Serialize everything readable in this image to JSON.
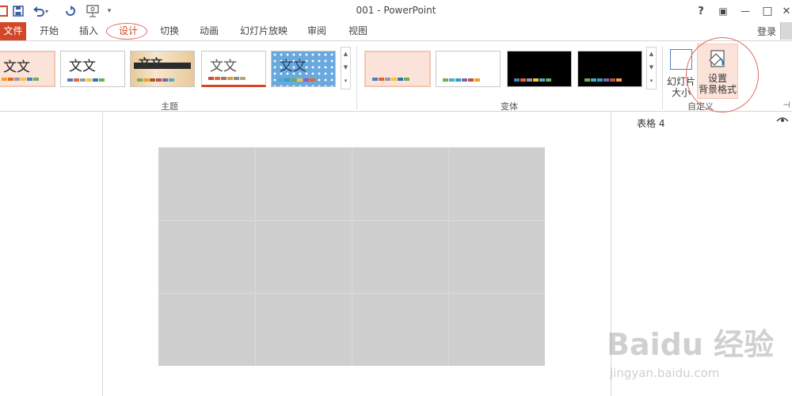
{
  "window": {
    "title": "001 - PowerPoint"
  },
  "quick_access": {
    "undo_dropdown": "▾",
    "customize": "▾"
  },
  "window_controls": {
    "help": "?",
    "restore_ribbon": "▣",
    "minimize": "—",
    "maximize": "□",
    "close": "✕"
  },
  "tabs": [
    {
      "label": "文件"
    },
    {
      "label": "开始"
    },
    {
      "label": "插入"
    },
    {
      "label": "设计"
    },
    {
      "label": "切换"
    },
    {
      "label": "动画"
    },
    {
      "label": "幻灯片放映"
    },
    {
      "label": "审阅"
    },
    {
      "label": "视图"
    }
  ],
  "account": {
    "login": "登录"
  },
  "ribbon": {
    "themes_group": {
      "label": "主题",
      "items": [
        {
          "label": "文文",
          "selected": true,
          "colors": [
            "#f0a02a",
            "#e8632b",
            "#9a9a9a",
            "#f6c43b",
            "#4a7ec0",
            "#6db050"
          ]
        },
        {
          "label": "文文",
          "selected": false,
          "colors": [
            "#4a7ec0",
            "#e8632b",
            "#9a9a9a",
            "#f6c43b",
            "#2f75b5",
            "#6db050"
          ]
        },
        {
          "label": "文文",
          "selected": false,
          "colors": [
            "#6db050",
            "#e8a12b",
            "#9c5c2c",
            "#c0504d",
            "#8064a2",
            "#4bacc6"
          ]
        },
        {
          "label": "文文",
          "selected": false,
          "colors": [
            "#c0504d",
            "#e8632b",
            "#9c7c5c",
            "#d4a03c",
            "#8a8a8a",
            "#b7a77a"
          ]
        },
        {
          "label": "文文",
          "selected": false,
          "colors": [
            "#4bacc6",
            "#2f9ed6",
            "#6db050",
            "#f6c43b",
            "#8e5db5",
            "#e8632b"
          ]
        }
      ]
    },
    "variants_group": {
      "label": "变体",
      "items": [
        {
          "bg": "#ffffff",
          "selected": true,
          "colors": [
            "#4a7ec0",
            "#e8632b",
            "#9a9a9a",
            "#f6c43b",
            "#2f75b5",
            "#6db050"
          ]
        },
        {
          "bg": "#ffffff",
          "selected": false,
          "colors": [
            "#6db050",
            "#4bacc6",
            "#2f9ed6",
            "#8064a2",
            "#c0504d",
            "#f0a02a"
          ]
        },
        {
          "bg": "#000000",
          "selected": false,
          "colors": [
            "#4a7ec0",
            "#e8632b",
            "#9a9a9a",
            "#f6c43b",
            "#4bacc6",
            "#6db050"
          ]
        },
        {
          "bg": "#000000",
          "selected": false,
          "colors": [
            "#6db050",
            "#4bacc6",
            "#2f9ed6",
            "#8064a2",
            "#c0504d",
            "#f0a02a"
          ]
        }
      ]
    },
    "customize_group": {
      "label": "自定义",
      "slide_size_line1": "幻灯片",
      "slide_size_line2": "大小",
      "format_bg_line1": "设置",
      "format_bg_line2": "背景格式"
    }
  },
  "right_pane": {
    "title": "表格 4"
  },
  "watermark": {
    "brand": "Baidu 经验",
    "url": "jingyan.baidu.com"
  }
}
